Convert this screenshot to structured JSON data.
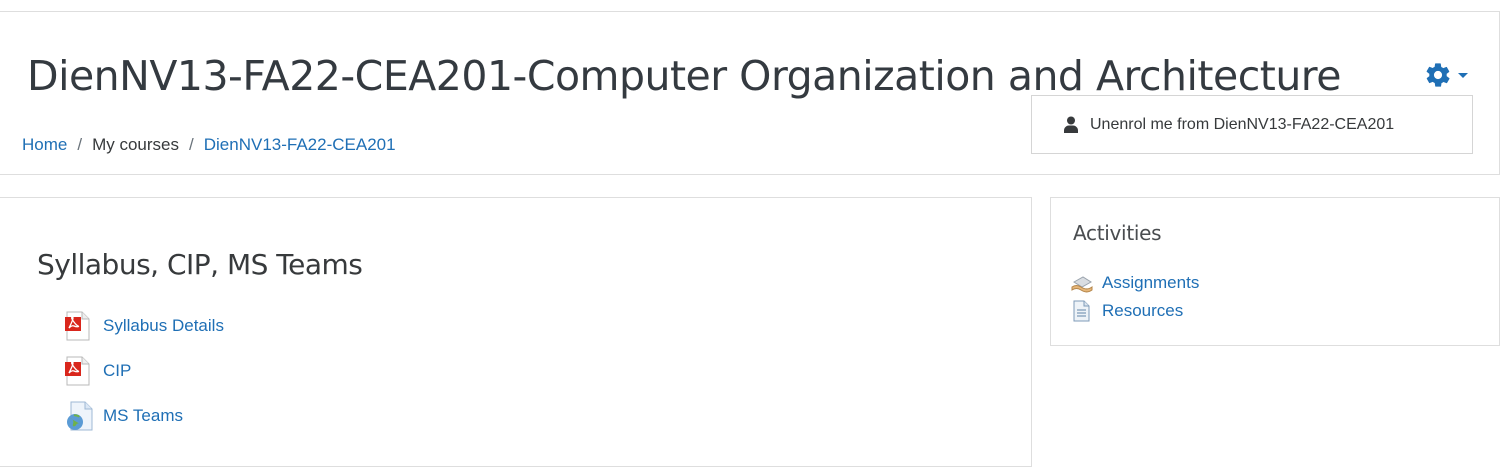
{
  "course": {
    "title": "DienNV13-FA22-CEA201-Computer Organization and Architecture"
  },
  "breadcrumb": {
    "items": [
      "Home",
      "My courses",
      "DienNV13-FA22-CEA201"
    ],
    "separator": "/"
  },
  "settings_menu": {
    "icon": "gear-icon",
    "accent_color": "#1f6fb5",
    "items": [
      {
        "label": "Unenrol me from DienNV13-FA22-CEA201",
        "icon": "user-icon"
      }
    ]
  },
  "section": {
    "title": "Syllabus, CIP, MS Teams",
    "activities": [
      {
        "name": "Syllabus Details",
        "icon": "pdf-icon"
      },
      {
        "name": "CIP",
        "icon": "pdf-icon"
      },
      {
        "name": "MS Teams",
        "icon": "url-globe-icon"
      }
    ]
  },
  "activities_block": {
    "title": "Activities",
    "items": [
      {
        "name": "Assignments",
        "icon": "assignment-icon"
      },
      {
        "name": "Resources",
        "icon": "resource-icon"
      }
    ]
  },
  "colors": {
    "link": "#1f6fb5",
    "text": "#373a3c",
    "border": "#dedede"
  }
}
